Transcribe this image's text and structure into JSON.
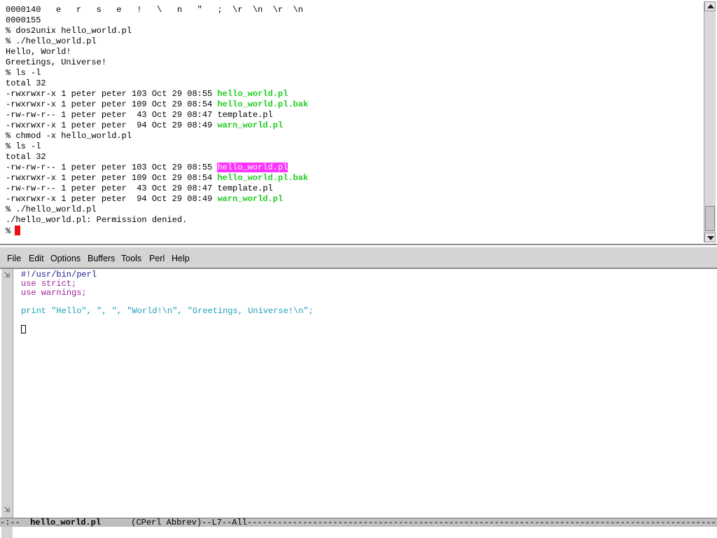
{
  "terminal": {
    "lines": [
      [
        {
          "t": "0000140   e   r   s   e   !   \\   n   \"   ;  \\r  \\n  \\r  \\n"
        }
      ],
      [
        {
          "t": "0000155"
        }
      ],
      [
        {
          "t": "% dos2unix hello_world.pl"
        }
      ],
      [
        {
          "t": "% ./hello_world.pl"
        }
      ],
      [
        {
          "t": "Hello, World!"
        }
      ],
      [
        {
          "t": "Greetings, Universe!"
        }
      ],
      [
        {
          "t": "% ls -l"
        }
      ],
      [
        {
          "t": "total 32"
        }
      ],
      [
        {
          "t": "-rwxrwxr-x 1 peter peter 103 Oct 29 08:55 "
        },
        {
          "t": "hello_world.pl",
          "c": "exec"
        }
      ],
      [
        {
          "t": "-rwxrwxr-x 1 peter peter 109 Oct 29 08:54 "
        },
        {
          "t": "hello_world.pl.bak",
          "c": "exec"
        }
      ],
      [
        {
          "t": "-rw-rw-r-- 1 peter peter  43 Oct 29 08:47 template.pl"
        }
      ],
      [
        {
          "t": "-rwxrwxr-x 1 peter peter  94 Oct 29 08:49 "
        },
        {
          "t": "warn_world.pl",
          "c": "exec"
        }
      ],
      [
        {
          "t": "% chmod -x hello_world.pl"
        }
      ],
      [
        {
          "t": "% ls -l"
        }
      ],
      [
        {
          "t": "total 32"
        }
      ],
      [
        {
          "t": "-rw-rw-r-- 1 peter peter 103 Oct 29 08:55 "
        },
        {
          "t": "hello_world.pl",
          "c": "hl"
        }
      ],
      [
        {
          "t": "-rwxrwxr-x 1 peter peter 109 Oct 29 08:54 "
        },
        {
          "t": "hello_world.pl.bak",
          "c": "exec"
        }
      ],
      [
        {
          "t": "-rw-rw-r-- 1 peter peter  43 Oct 29 08:47 template.pl"
        }
      ],
      [
        {
          "t": "-rwxrwxr-x 1 peter peter  94 Oct 29 08:49 "
        },
        {
          "t": "warn_world.pl",
          "c": "exec"
        }
      ],
      [
        {
          "t": "% ./hello_world.pl"
        }
      ],
      [
        {
          "t": "./hello_world.pl: Permission denied."
        }
      ],
      [
        {
          "t": "%"
        },
        {
          "t": "",
          "c": "cursor"
        }
      ]
    ],
    "colors": {
      "executable": "#22cc22",
      "highlight": "#ff33ff",
      "cursor": "#ee1111"
    }
  },
  "menubar": {
    "items": [
      "File",
      "Edit",
      "Options",
      "Buffers",
      "Tools",
      "Perl",
      "Help"
    ]
  },
  "editor": {
    "lines": [
      [
        {
          "t": "#!/usr/bin/perl",
          "c": "shebang"
        }
      ],
      [
        {
          "t": "use",
          "c": "kw"
        },
        {
          "t": " "
        },
        {
          "t": "strict",
          "c": "arg"
        },
        {
          "t": ";",
          "c": "punct"
        }
      ],
      [
        {
          "t": "use",
          "c": "kw"
        },
        {
          "t": " "
        },
        {
          "t": "warnings",
          "c": "arg"
        },
        {
          "t": ";",
          "c": "punct"
        }
      ],
      [],
      [
        {
          "t": "print",
          "c": "print"
        },
        {
          "t": " "
        },
        {
          "t": "\"Hello\"",
          "c": "str"
        },
        {
          "t": ", ",
          "c": "sep"
        },
        {
          "t": "\", \"",
          "c": "str"
        },
        {
          "t": ", ",
          "c": "sep"
        },
        {
          "t": "\"World!\\n\"",
          "c": "str"
        },
        {
          "t": ", ",
          "c": "sep"
        },
        {
          "t": "\"Greetings, Universe!\\n\"",
          "c": "str"
        },
        {
          "t": ";",
          "c": "sep"
        }
      ],
      [],
      [
        {
          "t": "",
          "c": "cursor"
        }
      ]
    ],
    "colors": {
      "keyword": "#a0209a",
      "string": "#1fa0b8",
      "shebang": "#1a1a8a"
    }
  },
  "modeline": {
    "prefix": "-:--  ",
    "buffer_name": "hello_world.pl",
    "mode_info": "      (CPerl Abbrev)--L7--All",
    "fill": "------------------------------------------------------------------------------------------------------------------------------------------------------"
  },
  "icons": {
    "fringe_top": "continuation-icon",
    "fringe_bottom": "continuation-icon"
  }
}
